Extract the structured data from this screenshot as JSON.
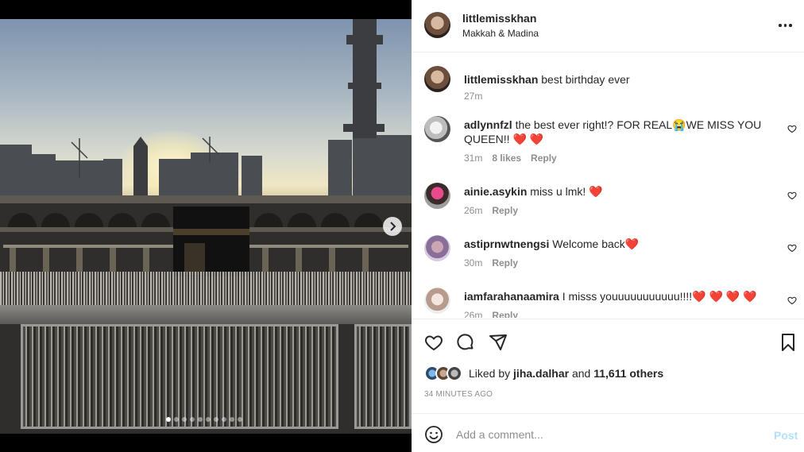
{
  "post": {
    "username": "littlemisskhan",
    "location": "Makkah & Madina",
    "caption": "best birthday ever",
    "caption_age": "27m",
    "carousel": {
      "total": 10,
      "active_index": 0
    }
  },
  "comments": [
    {
      "username": "adlynnfzl",
      "text": "the best ever right!? FOR REAL😭WE MISS YOU QUEEN!! ❤️ ❤️",
      "age": "31m",
      "likes": "8 likes",
      "reply": "Reply"
    },
    {
      "username": "ainie.asykin",
      "text": "miss u lmk! ❤️",
      "age": "26m",
      "reply": "Reply"
    },
    {
      "username": "astiprnwtnengsi",
      "text": "Welcome back❤️",
      "age": "30m",
      "reply": "Reply"
    },
    {
      "username": "iamfarahanaamira",
      "text": "I misss youuuuuuuuuuu!!!!❤️ ❤️ ❤️ ❤️",
      "age": "26m",
      "reply": "Reply"
    }
  ],
  "likes": {
    "prefix": "Liked by",
    "user": "jiha.dalhar",
    "and": "and",
    "others": "11,611 others"
  },
  "timestamp": "34 MINUTES AGO",
  "add_comment": {
    "placeholder": "Add a comment...",
    "post_label": "Post"
  },
  "colors": {
    "accent_disabled": "#b2dffc",
    "text": "#262626",
    "muted": "#8e8e8e",
    "heart": "#e0102f"
  },
  "icons": [
    "more-icon",
    "heart-icon",
    "comment-icon",
    "share-icon",
    "bookmark-icon",
    "emoji-icon",
    "chevron-right-icon"
  ]
}
